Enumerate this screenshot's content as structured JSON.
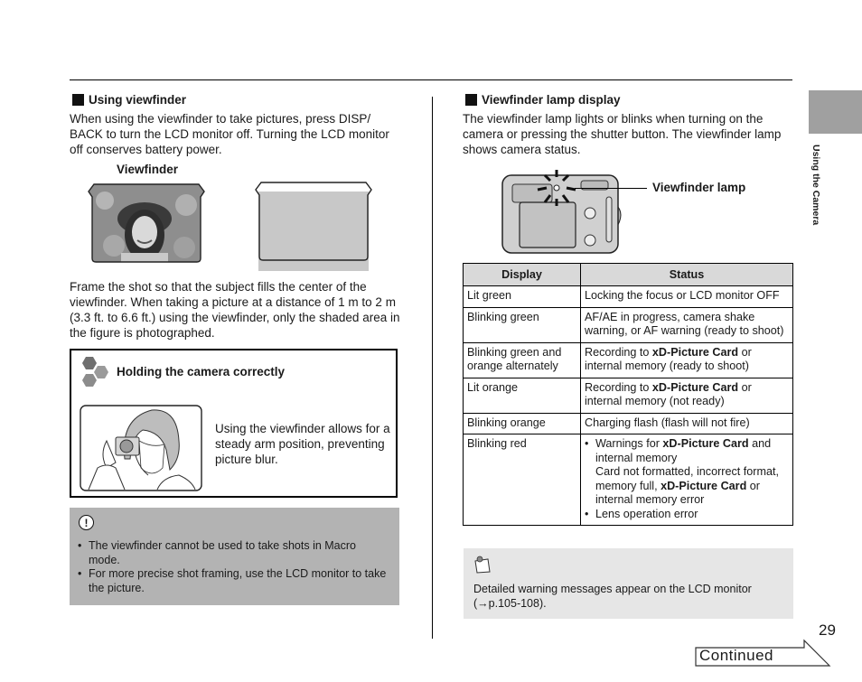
{
  "left": {
    "section_title": "Using viewfinder",
    "intro": "When using the viewfinder to take pictures, press DISP/ BACK to turn the LCD monitor off. Turning the LCD monitor off conserves battery power.",
    "viewfinder_label": "Viewfinder",
    "frame_text": "Frame the shot so that the subject fills the center of the viewfinder. When taking a picture at a distance of 1 m to 2 m (3.3 ft. to 6.6 ft.) using the viewfinder, only the shaded area in the figure is photographed.",
    "tip": {
      "icon": "hexagon-cluster-icon",
      "title": "Holding the camera correctly",
      "text": "Using the viewfinder allows for a steady arm position, preventing picture blur."
    },
    "caution": {
      "icon": "exclamation-circle-icon",
      "bullets": [
        "The viewfinder cannot be used to take shots in Macro mode.",
        "For more precise shot framing, use the LCD monitor to take the picture."
      ]
    }
  },
  "right": {
    "section_title": "Viewfinder lamp display",
    "intro": "The viewfinder lamp lights or blinks when turning on the camera or pressing the shutter button. The viewfinder lamp shows camera status.",
    "lamp_label": "Viewfinder lamp",
    "table": {
      "headers": [
        "Display",
        "Status"
      ],
      "rows": [
        {
          "display": "Lit green",
          "status": "Locking the focus or LCD monitor OFF"
        },
        {
          "display": "Blinking green",
          "status": "AF/AE in progress, camera shake warning, or AF warning (ready to shoot)"
        },
        {
          "display": "Blinking green and orange alternately",
          "status_pre": "Recording to ",
          "status_bold": "xD-Picture Card",
          "status_post": " or internal memory (ready to shoot)"
        },
        {
          "display": "Lit orange",
          "status_pre": "Recording to ",
          "status_bold": "xD-Picture Card",
          "status_post": " or internal memory (not ready)"
        },
        {
          "display": "Blinking orange",
          "status": "Charging flash (flash will not fire)"
        },
        {
          "display": "Blinking red",
          "bullet1_pre": "Warnings for ",
          "bullet1_bold": "xD-Picture Card",
          "bullet1_post": " and internal memory",
          "bullet1_detail_pre": "Card not formatted, incorrect format, memory full, ",
          "bullet1_detail_bold": "xD-Picture Card",
          "bullet1_detail_post": " or internal memory error",
          "bullet2": "Lens operation error"
        }
      ]
    },
    "note": {
      "icon": "memo-pin-icon",
      "text": "Detailed warning messages appear on the LCD monitor (→p.105-108)."
    }
  },
  "side_tab": {
    "label": "Using the Camera"
  },
  "footer": {
    "page_number": "29",
    "continued_label": "Continued"
  }
}
